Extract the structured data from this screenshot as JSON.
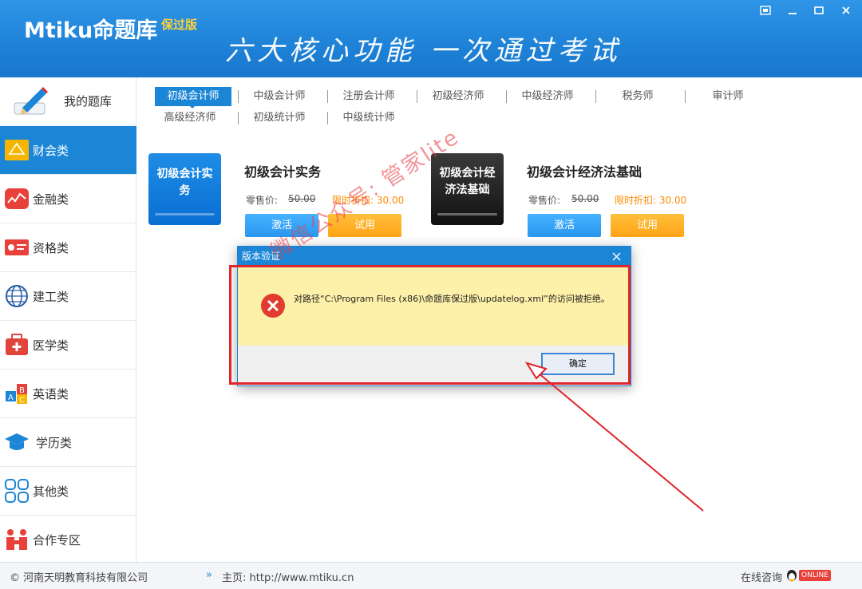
{
  "header": {
    "logo": "Mtiku命题库",
    "logo_tag": "保过版",
    "slogan": "六大核心功能 一次通过考试"
  },
  "sidebar": {
    "top_label": "我的题库",
    "items": [
      {
        "label": "财会类",
        "icon": "calculator-icon"
      },
      {
        "label": "金融类",
        "icon": "finance-chart-icon"
      },
      {
        "label": "资格类",
        "icon": "id-card-icon"
      },
      {
        "label": "建工类",
        "icon": "globe-icon"
      },
      {
        "label": "医学类",
        "icon": "medical-kit-icon"
      },
      {
        "label": "英语类",
        "icon": "abc-blocks-icon"
      },
      {
        "label": "学历类",
        "icon": "graduation-cap-icon"
      },
      {
        "label": "其他类",
        "icon": "grid-icon"
      },
      {
        "label": "合作专区",
        "icon": "handshake-icon"
      }
    ]
  },
  "tabs": {
    "row1": [
      "初级会计师",
      "中级会计师",
      "注册会计师",
      "初级经济师",
      "中级经济师",
      "税务师",
      "审计师"
    ],
    "row2": [
      "高级经济师",
      "初级统计师",
      "中级统计师"
    ]
  },
  "products": [
    {
      "cover": "初级会计实务",
      "title": "初级会计实务",
      "price_label": "零售价:",
      "price": "50.00",
      "discount": "限时折扣: 30.00",
      "activate": "激活",
      "trial": "试用"
    },
    {
      "cover": "初级会计经济法基础",
      "title": "初级会计经济法基础",
      "price_label": "零售价:",
      "price": "50.00",
      "discount": "限时折扣: 30.00",
      "activate": "激活",
      "trial": "试用"
    }
  ],
  "dialog": {
    "title": "版本验证",
    "message": "对路径“C:\\Program Files (x86)\\命题库保过版\\updatelog.xml”的访问被拒绝。",
    "ok": "确定"
  },
  "watermark": "微信公众号: 管家lite",
  "footer": {
    "copyright": "© 河南天明教育科技有限公司",
    "homepage": "主页: http://www.mtiku.cn",
    "consult": "在线咨询",
    "badge": "ONLINE"
  },
  "colors": {
    "brand_blue": "#1c86d6",
    "accent_orange": "#ff8a00",
    "annotation_red": "#e0262b"
  }
}
